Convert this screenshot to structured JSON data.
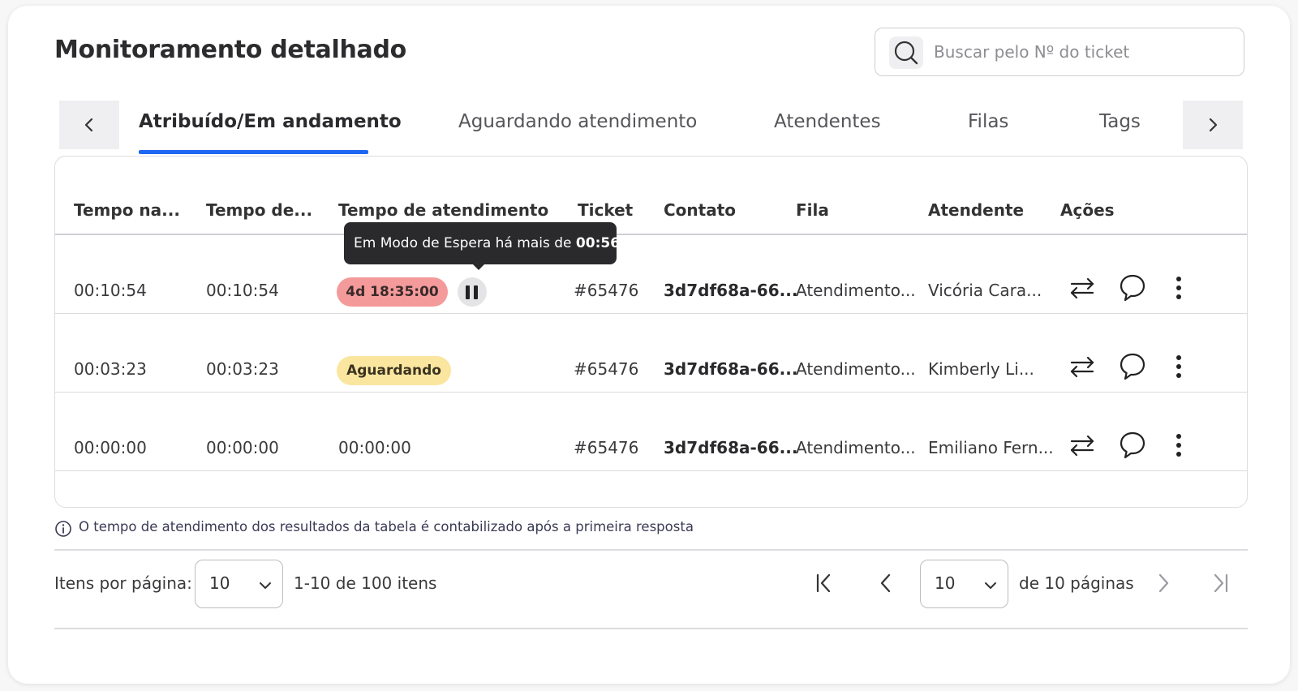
{
  "header": {
    "title": "Monitoramento detalhado",
    "search_placeholder": "Buscar pelo Nº do ticket"
  },
  "tabs": [
    {
      "label": "Atribuído/Em andamento",
      "active": true
    },
    {
      "label": "Aguardando atendimento",
      "active": false
    },
    {
      "label": "Atendentes",
      "active": false
    },
    {
      "label": "Filas",
      "active": false
    },
    {
      "label": "Tags",
      "active": false
    }
  ],
  "table": {
    "columns": [
      "Tempo na...",
      "Tempo de...",
      "Tempo de atendimento",
      "Ticket",
      "Contato",
      "Fila",
      "Atendente",
      "Ações"
    ],
    "rows": [
      {
        "tempo_na": "00:10:54",
        "tempo_de": "00:10:54",
        "atendimento": "4d 18:35:00",
        "atendimento_style": "red-badge-paused",
        "ticket": "#65476",
        "contato": "3d7df68a-66...",
        "fila": "Atendimento...",
        "atendente": "Vicória Cara..."
      },
      {
        "tempo_na": "00:03:23",
        "tempo_de": "00:03:23",
        "atendimento": "Aguardando",
        "atendimento_style": "yellow-badge",
        "ticket": "#65476",
        "contato": "3d7df68a-66...",
        "fila": "Atendimento...",
        "atendente": "Kimberly Li..."
      },
      {
        "tempo_na": "00:00:00",
        "tempo_de": "00:00:00",
        "atendimento": "00:00:00",
        "atendimento_style": "plain",
        "ticket": "#65476",
        "contato": "3d7df68a-66...",
        "fila": "Atendimento...",
        "atendente": "Emiliano Fern..."
      }
    ],
    "row_actions": [
      "transfer-icon",
      "chat-bubble-icon",
      "more-vertical-icon"
    ]
  },
  "tooltip": {
    "text": "Em Modo de Espera há mais de ",
    "time": "00:56"
  },
  "note": "O tempo de atendimento dos resultados da tabela é contabilizado após a primeira resposta",
  "pagination": {
    "items_per_page_label": "Itens por página:",
    "items_per_page_value": "10",
    "range_text": "1-10 de 100 itens",
    "page_value": "10",
    "pages_text": "de 10 páginas"
  },
  "colors": {
    "accent": "#1f66f2",
    "badge_red": "#f49a9a",
    "badge_yellow": "#fbe6a0",
    "tooltip_bg": "#2a2a2c"
  }
}
